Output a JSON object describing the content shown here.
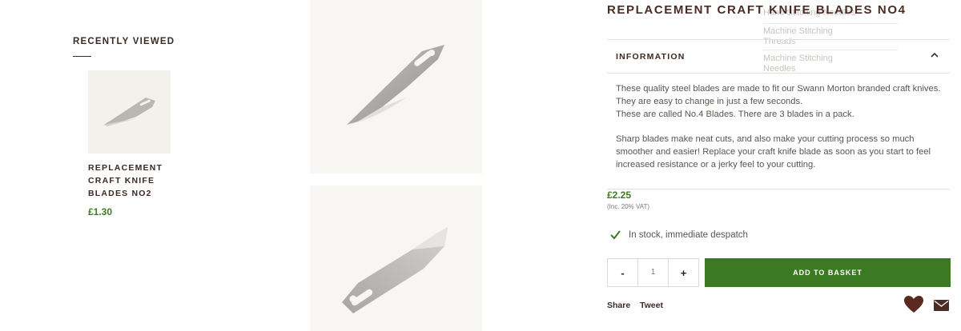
{
  "recently_viewed": {
    "heading": "RECENTLY VIEWED",
    "items": [
      {
        "title": "REPLACEMENT CRAFT KNIFE BLADES NO2",
        "price": "£1.30"
      }
    ]
  },
  "nav_dropdown": {
    "items": [
      "Hand Stitching Needles",
      "Machine Stitching Threads",
      "Machine Stitching Needles"
    ]
  },
  "product": {
    "title": "REPLACEMENT CRAFT KNIFE BLADES NO4",
    "information_heading": "INFORMATION",
    "description": [
      "These quality steel blades are made to fit our Swann Morton branded craft knives. They are easy to change in just a few seconds.",
      "These are called No.4 Blades.  There are 3 blades in a pack.",
      "Sharp blades make neat cuts, and also make your cutting process so much smoother and easier!  Replace your craft knife blade as soon as you start to feel increased resistance or a jerky feel to your cutting."
    ],
    "price": "£2.25",
    "vat_note": "(Inc. 20% VAT)",
    "stock": "In stock, immediate despatch",
    "quantity": "1",
    "decrement": "-",
    "increment": "+",
    "add_to_basket": "ADD TO BASKET"
  },
  "share": {
    "share_label": "Share",
    "tweet_label": "Tweet"
  },
  "colors": {
    "accent_green": "#3b7a22",
    "brand_brown": "#4a2c24",
    "heart": "#5a2a1f"
  },
  "icons": [
    "check-icon",
    "chevron-up-icon",
    "heart-icon",
    "mail-icon"
  ]
}
